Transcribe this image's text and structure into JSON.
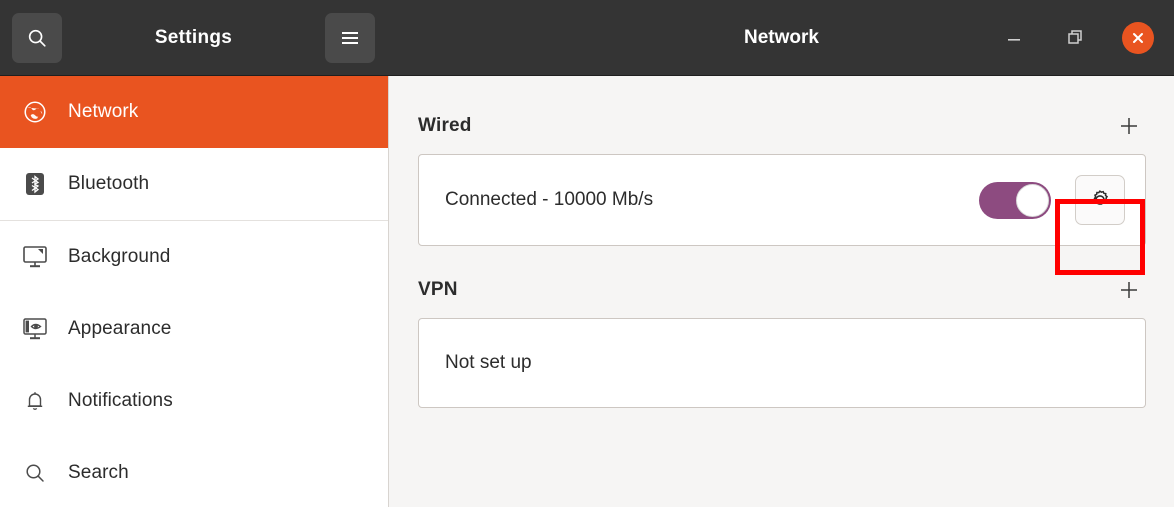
{
  "window": {
    "left_title": "Settings",
    "right_title": "Network",
    "search_icon": "search-icon",
    "menu_icon": "hamburger-menu-icon",
    "minimize_label": "Minimize",
    "maximize_label": "Restore",
    "close_label": "Close",
    "close_button_color": "#e95420",
    "titlebar_color": "#343434"
  },
  "sidebar": {
    "selected": "Network",
    "accent_color": "#e95420",
    "items": [
      {
        "label": "Network",
        "icon": "globe-icon",
        "selected": true
      },
      {
        "label": "Bluetooth",
        "icon": "bluetooth-icon",
        "selected": false
      },
      {
        "label": "Background",
        "icon": "monitor-wallpaper-icon",
        "selected": false
      },
      {
        "label": "Appearance",
        "icon": "monitor-eye-icon",
        "selected": false
      },
      {
        "label": "Notifications",
        "icon": "bell-icon",
        "selected": false
      },
      {
        "label": "Search",
        "icon": "magnifier-icon",
        "selected": false
      }
    ]
  },
  "main": {
    "background_color": "#f6f5f4",
    "sections": [
      {
        "title": "Wired",
        "add_label": "+",
        "row_label": "Connected - 10000 Mb/s",
        "toggle_state": "on",
        "toggle_color": "#8d4b80",
        "settings_icon": "gear-icon"
      },
      {
        "title": "VPN",
        "add_label": "+",
        "row_label": "Not set up"
      }
    ]
  },
  "annotation": {
    "type": "highlight-rectangle",
    "color": "#ff0000",
    "target": "wired-settings-gear-button"
  }
}
